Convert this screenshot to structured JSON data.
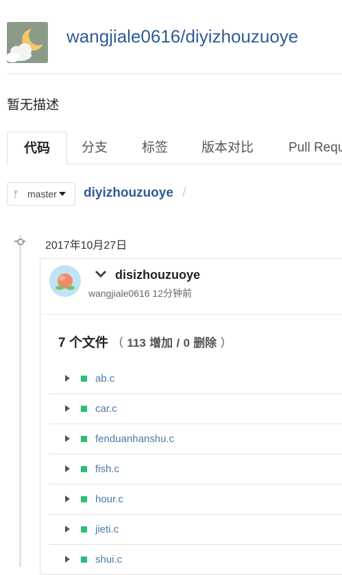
{
  "repo": {
    "full_name": "wangjiale0616/diyizhouzuoye",
    "description": "暂无描述"
  },
  "tabs": [
    {
      "label": "代码",
      "active": true
    },
    {
      "label": "分支"
    },
    {
      "label": "标签"
    },
    {
      "label": "版本对比"
    },
    {
      "label": "Pull Requ"
    }
  ],
  "branch": {
    "name": "master"
  },
  "breadcrumb": {
    "repo": "diyizhouzuoye",
    "separator": "/"
  },
  "timeline": {
    "date": "2017年10月27日"
  },
  "commit": {
    "title": "disizhouzuoye",
    "meta": "wangjiale0616 12分钟前"
  },
  "summary": {
    "files_text": "7 个文件",
    "open": "（",
    "additions_num": "113",
    "additions_label": "增加",
    "slash": "/",
    "deletions_num": "0",
    "deletions_label": "删除",
    "close": "）"
  },
  "files": [
    "ab.c",
    "car.c",
    "fenduanhanshu.c",
    "fish.c",
    "hour.c",
    "jieti.c",
    "shui.c"
  ],
  "colors": {
    "link": "#2f5c94",
    "file_link": "#4a78a8",
    "added": "#2cbe78"
  }
}
